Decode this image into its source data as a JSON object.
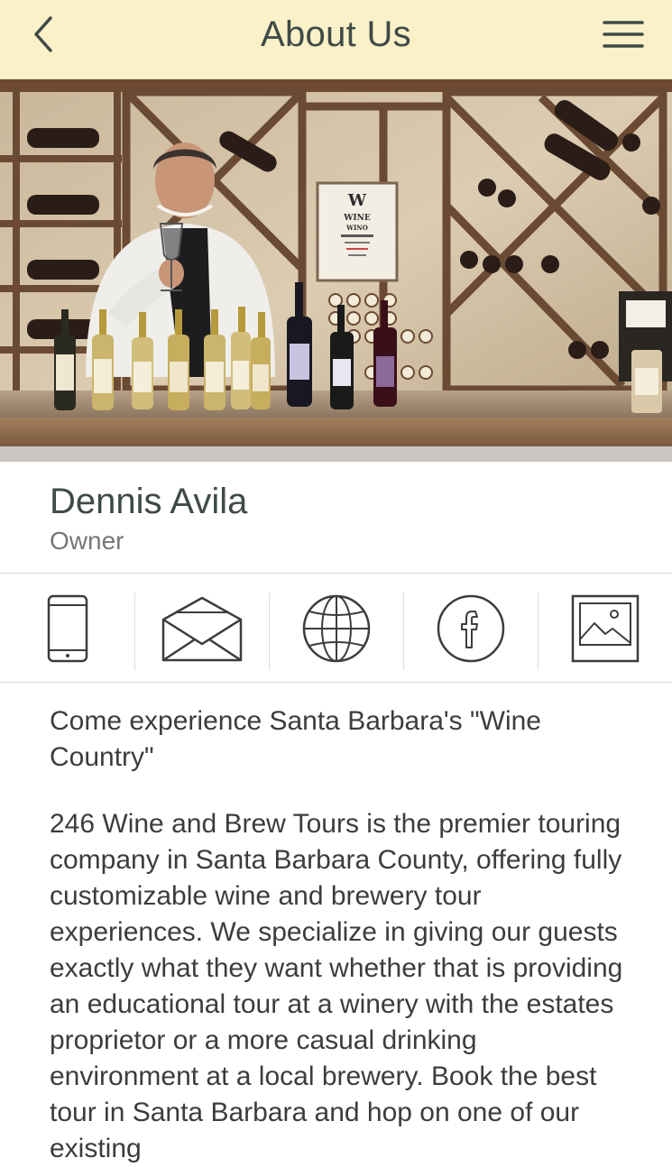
{
  "header": {
    "title": "About Us",
    "back_icon": "chevron-left-icon",
    "menu_icon": "hamburger-menu-icon"
  },
  "hero": {
    "image": "photo of a man holding a wine glass in a wine cellar with bottles on a wooden counter",
    "sign": {
      "line1": "W",
      "line2": "WINE",
      "line3": "WINO"
    }
  },
  "profile": {
    "name": "Dennis Avila",
    "role": "Owner"
  },
  "actions": [
    {
      "icon": "phone-icon"
    },
    {
      "icon": "email-icon"
    },
    {
      "icon": "globe-icon"
    },
    {
      "icon": "facebook-icon"
    },
    {
      "icon": "gallery-icon"
    }
  ],
  "content": {
    "heading": "Come experience Santa Barbara's \"Wine Country\"",
    "body": "246 Wine and Brew Tours is the premier touring company in Santa Barbara County, offering fully customizable wine and brewery tour experiences. We specialize in giving our guests exactly what they want whether that is providing an educational tour at a winery with the estates proprietor or a more casual drinking environment at a local brewery.  Book the best tour in Santa Barbara and hop on one of our existing"
  },
  "colors": {
    "header_bg": "#fbf1c8",
    "text": "#3a3d3f",
    "muted": "#777777",
    "divider": "#d9d9d9"
  }
}
